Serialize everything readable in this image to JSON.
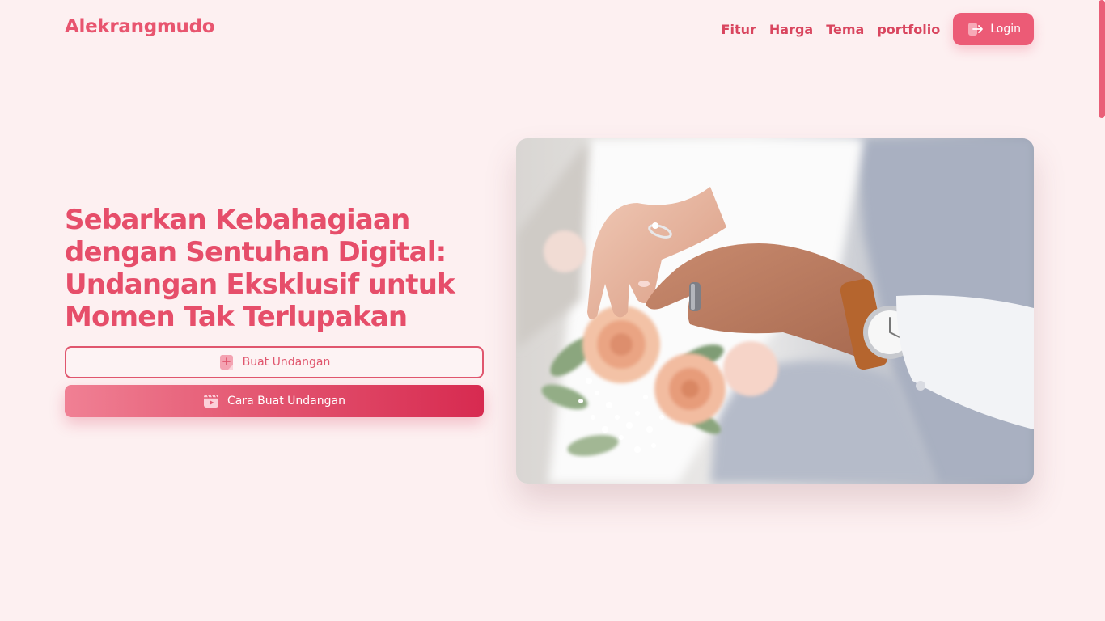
{
  "header": {
    "brand": "Alekrangmudo",
    "nav": [
      {
        "label": "Fitur"
      },
      {
        "label": "Harga"
      },
      {
        "label": "Tema"
      },
      {
        "label": "portfolio"
      }
    ],
    "login_label": "Login",
    "login_icon": "login-icon"
  },
  "hero": {
    "title": "Sebarkan Kebahagiaan dengan Sentuhan Digital: Undangan Eksklusif untuk Momen Tak Terlupakan",
    "primary_button": {
      "label": "Buat Undangan",
      "icon": "sparkle-note-icon"
    },
    "secondary_button": {
      "label": "Cara Buat Undangan",
      "icon": "video-play-icon"
    },
    "image": {
      "subject": "wedding-couple-hands-with-rings-and-bouquet"
    }
  },
  "colors": {
    "background": "#fdf0f1",
    "accent": "#e8556f",
    "accent_dark": "#d72a50"
  }
}
